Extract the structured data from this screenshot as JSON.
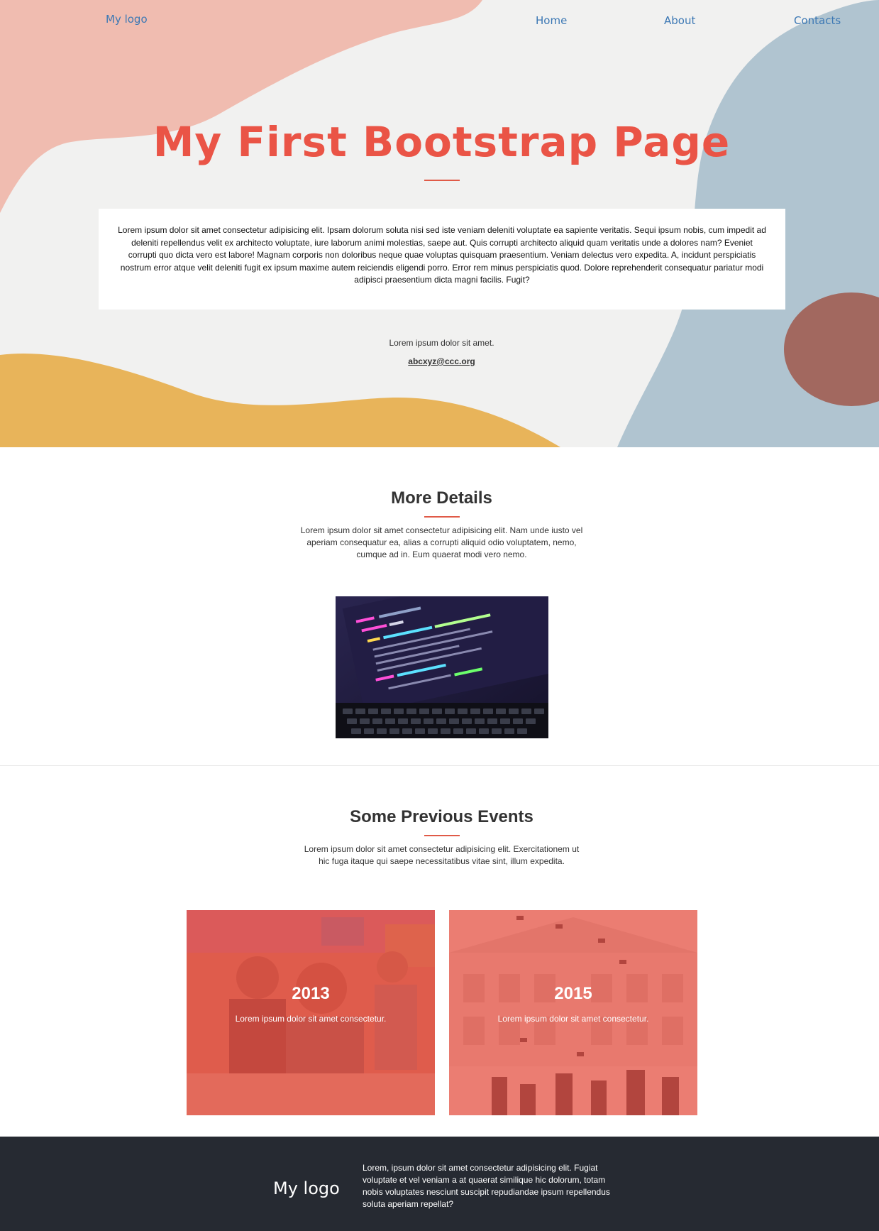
{
  "nav": {
    "logo": "My logo",
    "links": [
      "Home",
      "About",
      "Contacts"
    ]
  },
  "hero": {
    "title": "My First Bootstrap Page",
    "card_text": "Lorem ipsum dolor sit amet consectetur adipisicing elit. Ipsam dolorum soluta nisi sed iste veniam deleniti voluptate ea sapiente veritatis. Sequi ipsum nobis, cum impedit ad deleniti repellendus velit ex architecto voluptate, iure laborum animi molestias, saepe aut. Quis corrupti architecto aliquid quam veritatis unde a dolores nam? Eveniet corrupti quo dicta vero est labore! Magnam corporis non doloribus neque quae voluptas quisquam praesentium. Veniam delectus vero expedita. A, incidunt perspiciatis nostrum error atque velit deleniti fugit ex ipsum maxime autem reiciendis eligendi porro. Error rem minus perspiciatis quod. Dolore reprehenderit consequatur pariatur modi adipisci praesentium dicta magni facilis. Fugit?",
    "small_text": "Lorem ipsum dolor sit amet.",
    "email": "abcxyz@ccc.org"
  },
  "details": {
    "title": "More Details",
    "text": "Lorem ipsum dolor sit amet consectetur adipisicing elit. Nam unde iusto vel aperiam consequatur ea, alias a corrupti aliquid odio voluptatem, nemo, cumque ad in. Eum quaerat modi vero nemo."
  },
  "events": {
    "title": "Some Previous Events",
    "text": "Lorem ipsum dolor sit amet consectetur adipisicing elit. Exercitationem ut hic fuga itaque qui saepe necessitatibus vitae sint, illum expedita.",
    "cards": [
      {
        "year": "2013",
        "desc": "Lorem ipsum dolor sit amet consectetur."
      },
      {
        "year": "2015",
        "desc": "Lorem ipsum dolor sit amet consectetur."
      }
    ]
  },
  "footer": {
    "logo": "My logo",
    "text": "Lorem, ipsum dolor sit amet consectetur adipisicing elit. Fugiat voluptate et vel veniam a at quaerat similique hic dolorum, totam nobis voluptates nesciunt suscipit repudiandae ipsum repellendus soluta aperiam repellat?"
  },
  "colors": {
    "accent": "#ea5446",
    "link": "#3c78b4",
    "footer_bg": "#262a32",
    "blob_pink": "#f0b3a4",
    "blob_blue": "#a9bfcc",
    "blob_yellow": "#e8b45a",
    "blob_brown": "#a0584b"
  }
}
